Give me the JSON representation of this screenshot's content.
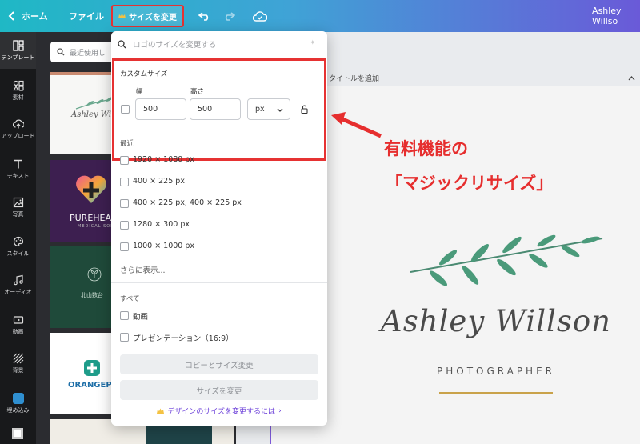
{
  "topbar": {
    "home_label": "ホーム",
    "file_label": "ファイル",
    "resize_label": "サイズを変更",
    "user_name": "Ashley Willso"
  },
  "rail": {
    "items": [
      {
        "label": "テンプレート"
      },
      {
        "label": "素材"
      },
      {
        "label": "アップロード"
      },
      {
        "label": "テキスト"
      },
      {
        "label": "写真"
      },
      {
        "label": "スタイル"
      },
      {
        "label": "オーディオ"
      },
      {
        "label": "動画"
      },
      {
        "label": "背景"
      },
      {
        "label": "埋め込み"
      }
    ]
  },
  "panel": {
    "search_placeholder": "最近使用し",
    "thumbs": [
      {
        "title": "Ashley Willso"
      },
      {
        "title": "PUREHEALTH",
        "sub": "MEDICAL SOLUTION"
      },
      {
        "title": "北山数台"
      },
      {
        "title": "ORANGEPLUS"
      }
    ]
  },
  "canvas": {
    "title_placeholder": "タイトルを追加",
    "logo_name": "Ashley Willson",
    "logo_sub": "PHOTOGRAPHER"
  },
  "dropdown": {
    "search_placeholder": "ロゴのサイズを変更する",
    "custom_size_label": "カスタムサイズ",
    "width_label": "幅",
    "height_label": "高さ",
    "width_value": "500",
    "height_value": "500",
    "unit_value": "px",
    "recent_label": "最近",
    "recent": [
      {
        "label": "1920 × 1080 px"
      },
      {
        "label": "400 × 225 px"
      },
      {
        "label": "400 × 225 px, 400 × 225 px"
      },
      {
        "label": "1280 × 300 px"
      },
      {
        "label": "1000 × 1000 px"
      }
    ],
    "show_more": "さらに表示...",
    "all_label": "すべて",
    "all": [
      {
        "label": "動画"
      },
      {
        "label": "プレゼンテーション（16:9）"
      }
    ],
    "copy_resize_button": "コピーとサイズ変更",
    "resize_button": "サイズを変更",
    "help_link": "デザインのサイズを変更するには"
  },
  "annotation": {
    "line1": "有料機能の",
    "line2": "「マジックリサイズ」"
  },
  "colors": {
    "highlight": "#e63232",
    "accent_purple": "#6b3fd9",
    "leaf_green": "#4a9a7a",
    "gold_line": "#c9a24a"
  }
}
